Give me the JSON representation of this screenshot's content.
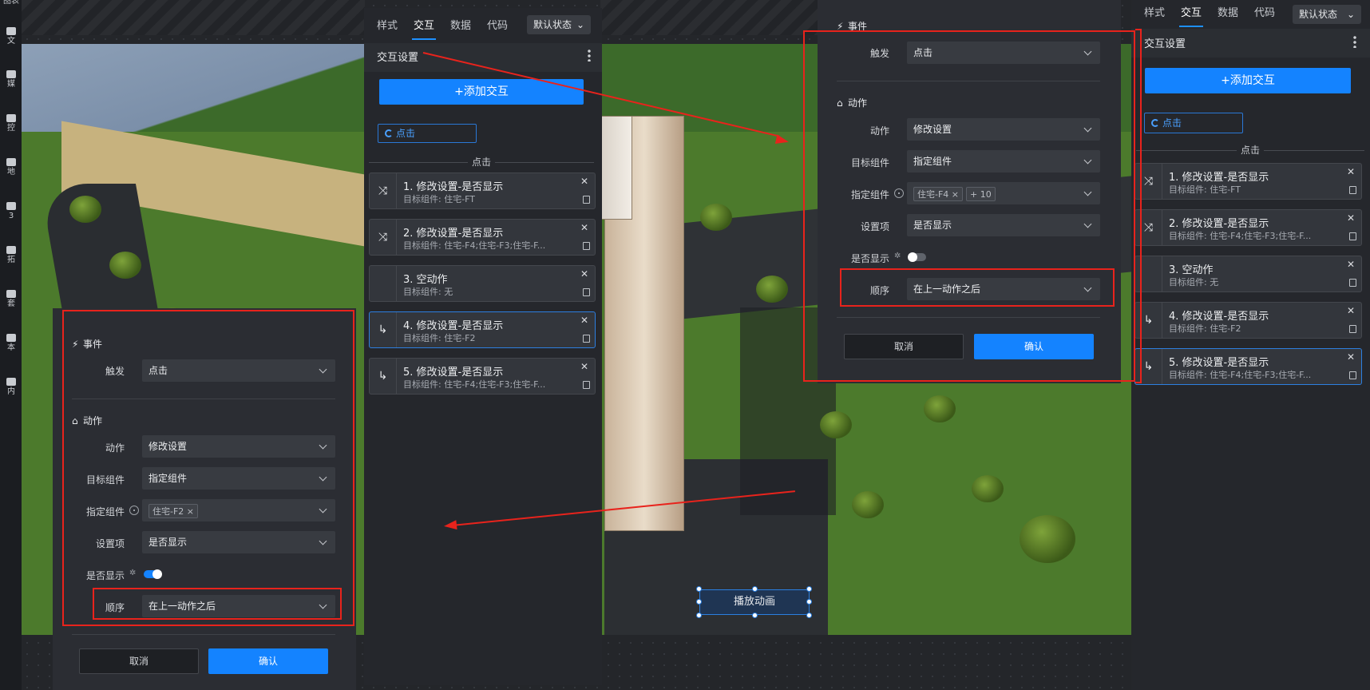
{
  "toolbar": {
    "items": [
      {
        "label": "文",
        "icon": "file-icon"
      },
      {
        "label": "媒",
        "icon": "media-icon"
      },
      {
        "label": "控",
        "icon": "control-icon"
      },
      {
        "label": "地",
        "icon": "map-icon"
      },
      {
        "label": "3",
        "icon": "3d-icon"
      },
      {
        "label": "拓",
        "icon": "extend-icon"
      },
      {
        "label": "套",
        "icon": "suite-icon"
      },
      {
        "label": "本",
        "icon": "local-icon"
      },
      {
        "label": "内",
        "icon": "builtin-icon"
      }
    ],
    "top_label": "图表"
  },
  "canvas": {
    "play_button_label": "播放动画"
  },
  "middle_panel": {
    "tabs": [
      "样式",
      "交互",
      "数据",
      "代码"
    ],
    "active_tab": "交互",
    "state_select": "默认状态",
    "section_title": "交互设置",
    "add_button": "+添加交互",
    "trigger_chip": "点击",
    "divider": "点击",
    "cards": [
      {
        "title": "1. 修改设置-是否显示",
        "subtitle": "目标组件: 住宅-FT",
        "icon": "branch-icon"
      },
      {
        "title": "2. 修改设置-是否显示",
        "subtitle": "目标组件: 住宅-F4;住宅-F3;住宅-F...",
        "icon": "branch-icon"
      },
      {
        "title": "3. 空动作",
        "subtitle": "目标组件: 无",
        "icon": ""
      },
      {
        "title": "4. 修改设置-是否显示",
        "subtitle": "目标组件: 住宅-F2",
        "icon": "subsequent-icon"
      },
      {
        "title": "5. 修改设置-是否显示",
        "subtitle": "目标组件: 住宅-F4;住宅-F3;住宅-F...",
        "icon": "subsequent-icon"
      }
    ],
    "selected_index": 3
  },
  "right_panel": {
    "tabs": [
      "样式",
      "交互",
      "数据",
      "代码"
    ],
    "active_tab": "交互",
    "state_select": "默认状态",
    "section_title": "交互设置",
    "add_button": "+添加交互",
    "trigger_chip": "点击",
    "divider": "点击",
    "cards": [
      {
        "title": "1. 修改设置-是否显示",
        "subtitle": "目标组件: 住宅-FT",
        "icon": "branch-icon"
      },
      {
        "title": "2. 修改设置-是否显示",
        "subtitle": "目标组件: 住宅-F4;住宅-F3;住宅-F...",
        "icon": "branch-icon"
      },
      {
        "title": "3. 空动作",
        "subtitle": "目标组件: 无",
        "icon": ""
      },
      {
        "title": "4. 修改设置-是否显示",
        "subtitle": "目标组件: 住宅-F2",
        "icon": "subsequent-icon"
      },
      {
        "title": "5. 修改设置-是否显示",
        "subtitle": "目标组件: 住宅-F4;住宅-F3;住宅-F...",
        "icon": "subsequent-icon"
      }
    ],
    "selected_index": 4
  },
  "dialog_left": {
    "event_header": "事件",
    "trigger_label": "触发",
    "trigger_value": "点击",
    "action_header": "动作",
    "action_label": "动作",
    "action_value": "修改设置",
    "target_label": "目标组件",
    "target_value": "指定组件",
    "specified_label": "指定组件",
    "specified_tags": [
      "住宅-F2"
    ],
    "setting_label": "设置项",
    "setting_value": "是否显示",
    "visible_label": "是否显示",
    "visible_on": true,
    "order_label": "顺序",
    "order_value": "在上一动作之后",
    "cancel": "取消",
    "confirm": "确认"
  },
  "dialog_right": {
    "event_header": "事件",
    "trigger_label": "触发",
    "trigger_value": "点击",
    "action_header": "动作",
    "action_label": "动作",
    "action_value": "修改设置",
    "target_label": "目标组件",
    "target_value": "指定组件",
    "specified_label": "指定组件",
    "specified_tags": [
      "住宅-F4",
      "+ 10"
    ],
    "setting_label": "设置项",
    "setting_value": "是否显示",
    "visible_label": "是否显示",
    "visible_on": false,
    "order_label": "顺序",
    "order_value": "在上一动作之后",
    "cancel": "取消",
    "confirm": "确认"
  },
  "colors": {
    "accent": "#1483ff",
    "annotation_red": "#e8231c",
    "panel_bg": "#25272c"
  }
}
